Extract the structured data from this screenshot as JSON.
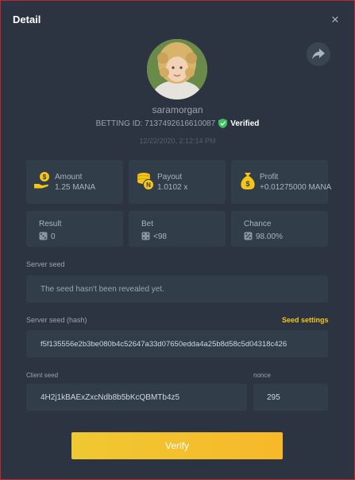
{
  "header": {
    "title": "Detail",
    "close_glyph": "×"
  },
  "profile": {
    "username": "saramorgan",
    "betting_id_text": "BETTING ID: 7137492616610087",
    "verified_label": "Verified",
    "timestamp": "12/22/2020, 2:12:14 PM"
  },
  "stats": {
    "amount": {
      "label": "Amount",
      "value": "1.25 MANA",
      "icon": "money-hand-icon"
    },
    "payout": {
      "label": "Payout",
      "value": "1.0102 x",
      "icon": "coins-icon"
    },
    "profit": {
      "label": "Profit",
      "value": "+0.01275000 MANA",
      "icon": "money-bag-icon"
    },
    "result": {
      "label": "Result",
      "value": "0",
      "icon": "dice-icon"
    },
    "bet": {
      "label": "Bet",
      "value": "<98",
      "icon": "dice-icon"
    },
    "chance": {
      "label": "Chance",
      "value": "98.00%",
      "icon": "percent-icon"
    }
  },
  "server_seed": {
    "label": "Server seed",
    "value": "The seed hasn't been revealed yet."
  },
  "server_seed_hash": {
    "label": "Server seed (hash)",
    "settings_link": "Seed settings",
    "value": "f5f135556e2b3be080b4c52647a33d07650edda4a25b8d58c5d04318c426"
  },
  "client_seed": {
    "label": "Client seed",
    "value": "4H2j1kBAExZxcNdb8b5bKcQBMTb4z5"
  },
  "nonce": {
    "label": "nonce",
    "value": "295"
  },
  "actions": {
    "verify_label": "Verify"
  },
  "colors": {
    "background": "#2b3440",
    "card": "#323d4a",
    "accent": "#f5c518",
    "verified": "#3cc35a",
    "border": "#c0262d"
  }
}
